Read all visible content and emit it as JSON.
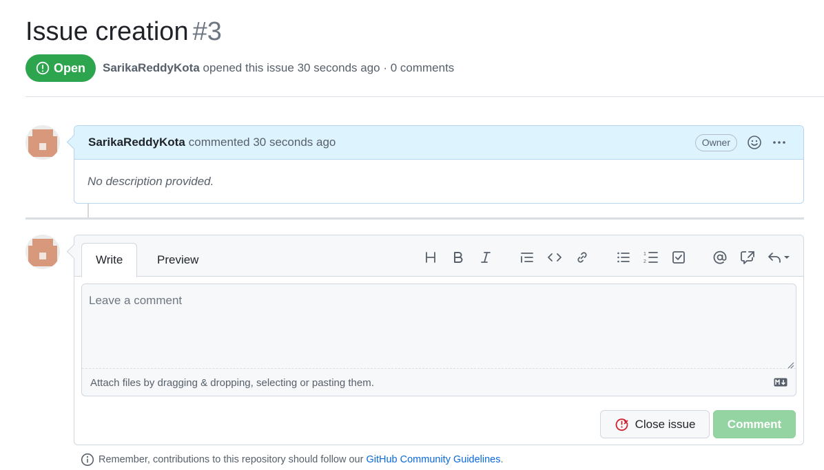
{
  "issue": {
    "title": "Issue creation",
    "number": "#3",
    "state": "Open",
    "author": "SarikaReddyKota",
    "meta": "opened this issue 30 seconds ago · 0 comments"
  },
  "comment": {
    "author": "SarikaReddyKota",
    "action": "commented 30 seconds ago",
    "role_badge": "Owner",
    "body": "No description provided."
  },
  "editor": {
    "tabs": [
      {
        "label": "Write",
        "active": true
      },
      {
        "label": "Preview",
        "active": false
      }
    ],
    "toolbar_icons": [
      "heading-icon",
      "bold-icon",
      "italic-icon",
      "quote-icon",
      "code-icon",
      "link-icon",
      "unordered-list-icon",
      "ordered-list-icon",
      "task-list-icon",
      "mention-icon",
      "reference-icon",
      "saved-replies-icon"
    ],
    "placeholder": "Leave a comment",
    "attach_text": "Attach files by dragging & dropping, selecting or pasting them."
  },
  "buttons": {
    "close_issue": "Close issue",
    "comment": "Comment"
  },
  "footer": {
    "text": "Remember, contributions to this repository should follow our",
    "link": "GitHub Community Guidelines",
    "suffix": "."
  },
  "colors": {
    "open_green": "#2da44e",
    "comment_disabled_green": "#94d3a2",
    "header_blue": "#ddf4ff",
    "link_blue": "#0969da",
    "close_red": "#cf222e"
  }
}
